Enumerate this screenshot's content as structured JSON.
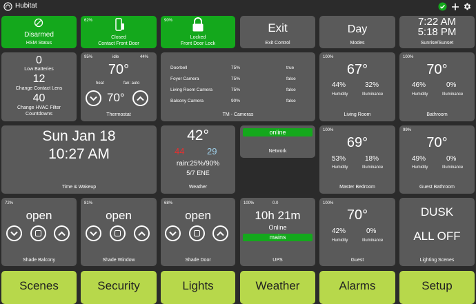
{
  "header": {
    "title": "Hubitat"
  },
  "hsm": {
    "state": "Disarmed",
    "label": "HSM Status"
  },
  "door_contact": {
    "battery": "62%",
    "state": "Closed",
    "label": "Contact Front Door"
  },
  "door_lock": {
    "battery": "90%",
    "state": "Locked",
    "label": "Front Door Lock"
  },
  "exit": {
    "title": "Exit",
    "label": "Exit Control"
  },
  "modes": {
    "value": "Day",
    "label": "Modes"
  },
  "sun": {
    "sunrise": "7:22 AM",
    "sunset": "5:18 PM",
    "label": "Sunrise/Sunset"
  },
  "countdowns": {
    "label": "Countdowns",
    "items": [
      {
        "count": "0",
        "label": "Low Batteries"
      },
      {
        "count": "12",
        "label": "Change Contact Lens"
      },
      {
        "count": "40",
        "label": "Change HVAC Filter"
      }
    ]
  },
  "thermostat": {
    "battery": "95%",
    "state": "idle",
    "humidity": "44%",
    "temp": "70°",
    "mode": "heat",
    "fan": "fan: auto",
    "setpoint": "70°",
    "label": "Thermostat"
  },
  "cameras": {
    "label": "TM - Cameras",
    "rows": [
      {
        "name": "Doorbell",
        "battery": "75%",
        "state": "true"
      },
      {
        "name": "Foyer Camera",
        "battery": "75%",
        "state": "false"
      },
      {
        "name": "Living Room Camera",
        "battery": "75%",
        "state": "false"
      },
      {
        "name": "Balcony Camera",
        "battery": "90%",
        "state": "false"
      }
    ]
  },
  "living_room": {
    "battery": "100%",
    "temp": "67°",
    "humidity": "44%",
    "illuminance": "32%",
    "humidity_label": "Humidity",
    "illuminance_label": "Illuminance",
    "label": "Living Room"
  },
  "bathroom": {
    "battery": "100%",
    "temp": "70°",
    "humidity": "46%",
    "illuminance": "0%",
    "humidity_label": "Humidity",
    "illuminance_label": "Illuminance",
    "label": "Bathroom"
  },
  "clock": {
    "date": "Sun Jan 18",
    "time": "10:27 AM",
    "label": "Time & Wakeup"
  },
  "weather": {
    "temp": "42°",
    "high": "44",
    "low": "29",
    "rain": "rain:25%/90%",
    "wind": "5/7 ENE",
    "label": "Weather",
    "high_color": "#e53030",
    "low_color": "#9fd0ea"
  },
  "network": {
    "status": "online",
    "label": "Network"
  },
  "master_bedroom": {
    "battery": "100%",
    "temp": "69°",
    "humidity": "53%",
    "illuminance": "18%",
    "humidity_label": "Humidity",
    "illuminance_label": "Illuminance",
    "label": "Master Bedroom"
  },
  "guest_bathroom": {
    "battery": "99%",
    "temp": "70°",
    "humidity": "49%",
    "illuminance": "0%",
    "humidity_label": "Humidity",
    "illuminance_label": "Illuminance",
    "label": "Guest Bathroom"
  },
  "shade_balcony": {
    "battery": "72%",
    "state": "open",
    "label": "Shade Balcony"
  },
  "shade_window": {
    "battery": "81%",
    "state": "open",
    "label": "Shade Window"
  },
  "shade_door": {
    "battery": "68%",
    "state": "open",
    "label": "Shade Door"
  },
  "ups": {
    "battery": "100%",
    "load": "0.0",
    "runtime": "10h 21m",
    "status": "Online",
    "power": "mains",
    "label": "UPS"
  },
  "guest": {
    "battery": "100%",
    "temp": "70°",
    "humidity": "42%",
    "illuminance": "0%",
    "humidity_label": "Humidity",
    "illuminance_label": "Illuminance",
    "label": "Guest"
  },
  "lighting": {
    "scene": "DUSK",
    "state": "ALL OFF",
    "label": "Lighting Scenes"
  },
  "nav": [
    "Scenes",
    "Security",
    "Lights",
    "Weather",
    "Alarms",
    "Setup"
  ],
  "icons": {
    "hsm": "disarmed-circle-slash-icon",
    "contact": "door-contact-icon",
    "lock": "padlock-icon",
    "status": "check-circle-icon",
    "add": "plus-icon",
    "settings": "gear-icon"
  },
  "colors": {
    "background": "#2b2b2b",
    "tile": "#5a5a5a",
    "active": "#14a81c",
    "nav": "#b7d84b"
  }
}
